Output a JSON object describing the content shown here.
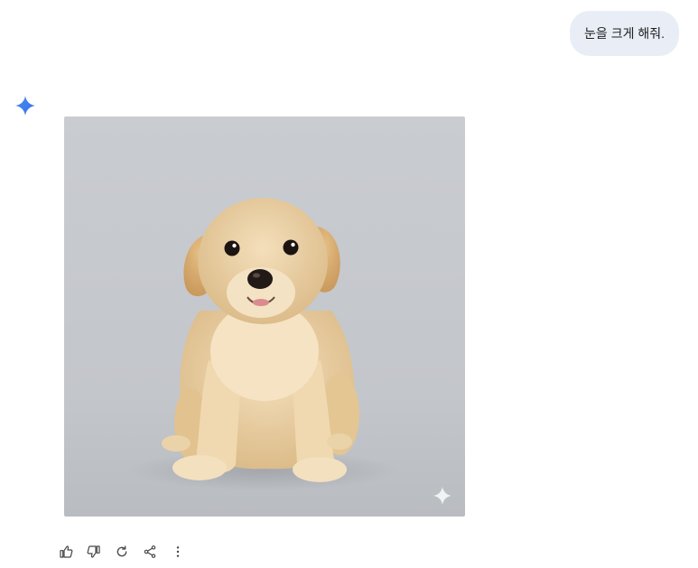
{
  "user_message": {
    "text": "눈을 크게 해줘."
  },
  "response": {
    "image": {
      "subject": "golden-retriever-puppy-icon"
    },
    "actions": [
      {
        "name": "thumbs-up-icon"
      },
      {
        "name": "thumbs-down-icon"
      },
      {
        "name": "regenerate-icon"
      },
      {
        "name": "share-icon"
      },
      {
        "name": "more-vert-icon"
      }
    ]
  },
  "colors": {
    "user_bubble": "#e9eef6",
    "gemini_spark": "#4285f4",
    "image_bg": "#c8cbd0",
    "puppy_fur": "#e9cfa3"
  }
}
